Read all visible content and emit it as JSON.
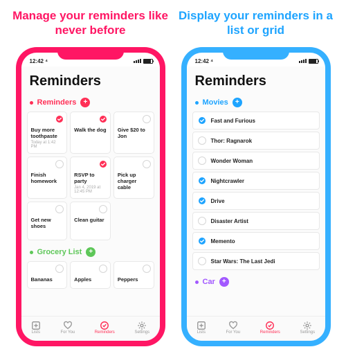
{
  "panels": {
    "left": {
      "headline": "Manage your reminders like never before",
      "accent": "#ff1664",
      "status_time": "12:42 ⁴",
      "app_title": "Reminders",
      "sections": [
        {
          "title": "Reminders",
          "color": "red",
          "layout": "grid",
          "items": [
            {
              "label": "Buy more toothpaste",
              "sub": "Today at 1:42 PM",
              "checked": true
            },
            {
              "label": "Walk the dog",
              "sub": "",
              "checked": true
            },
            {
              "label": "Give $20 to Jon",
              "sub": "",
              "checked": false
            },
            {
              "label": "Finish homework",
              "sub": "",
              "checked": false
            },
            {
              "label": "RSVP to party",
              "sub": "Jan 4, 2019 at 12:45 PM",
              "checked": true
            },
            {
              "label": "Pick up charger cable",
              "sub": "",
              "checked": false
            },
            {
              "label": "Get new shoes",
              "sub": "",
              "checked": false
            },
            {
              "label": "Clean guitar",
              "sub": "",
              "checked": false
            }
          ]
        },
        {
          "title": "Grocery List",
          "color": "green",
          "layout": "grid",
          "items": [
            {
              "label": "Bananas",
              "sub": "",
              "checked": false
            },
            {
              "label": "Apples",
              "sub": "",
              "checked": false
            },
            {
              "label": "Peppers",
              "sub": "",
              "checked": false
            }
          ]
        }
      ]
    },
    "right": {
      "headline": "Display your reminders in a list or grid",
      "accent": "#35b0ff",
      "status_time": "12:42 ⁴",
      "app_title": "Reminders",
      "sections": [
        {
          "title": "Movies",
          "color": "blue",
          "layout": "list",
          "items": [
            {
              "label": "Fast and Furious",
              "checked": true
            },
            {
              "label": "Thor: Ragnarok",
              "checked": false
            },
            {
              "label": "Wonder Woman",
              "checked": false
            },
            {
              "label": "Nightcrawler",
              "checked": true
            },
            {
              "label": "Drive",
              "checked": true
            },
            {
              "label": "Disaster Artist",
              "checked": false
            },
            {
              "label": "Memento",
              "checked": true
            },
            {
              "label": "Star Wars: The Last Jedi",
              "checked": false
            }
          ]
        },
        {
          "title": "Car",
          "color": "purple",
          "layout": "list",
          "items": []
        }
      ]
    }
  },
  "tabbar": {
    "items": [
      {
        "label": "Lists",
        "icon": "plus-square-icon",
        "active": false
      },
      {
        "label": "For You",
        "icon": "heart-icon",
        "active": false
      },
      {
        "label": "Reminders",
        "icon": "check-circle-icon",
        "active": true
      },
      {
        "label": "Settings",
        "icon": "gear-icon",
        "active": false
      }
    ]
  }
}
